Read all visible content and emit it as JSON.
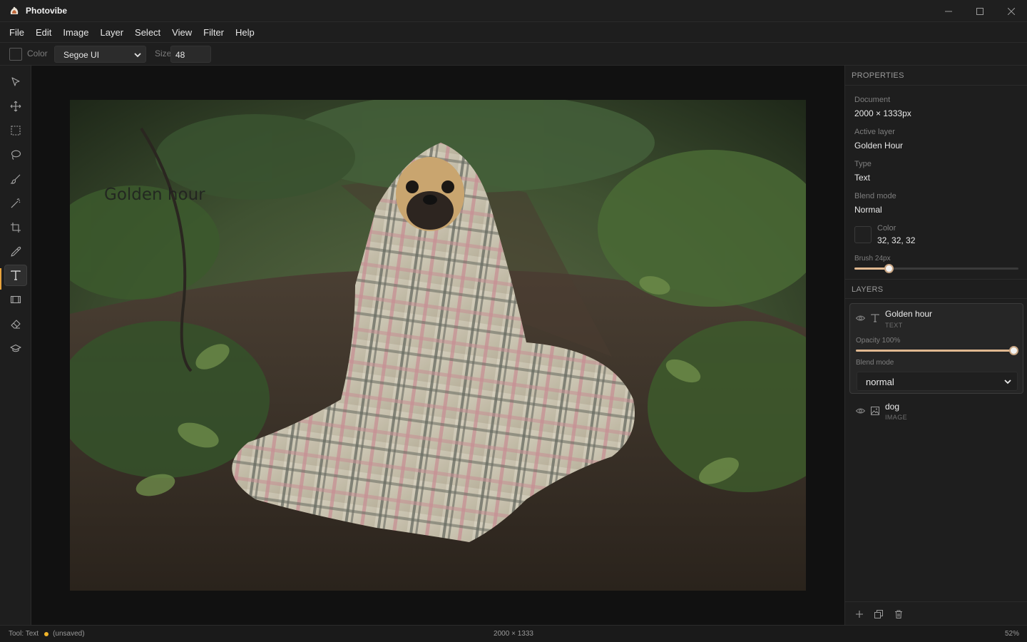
{
  "app": {
    "title": "Photovibe",
    "menu": [
      "File",
      "Edit",
      "Image",
      "Layer",
      "Select",
      "View",
      "Filter",
      "Help"
    ]
  },
  "options": {
    "color_label": "Color",
    "font": "Segoe UI",
    "size_label": "Size",
    "size_value": "48"
  },
  "toolbar": {
    "tools": [
      "select-tool",
      "move-tool",
      "marquee-tool",
      "lasso-tool",
      "brush-tool",
      "magic-wand-tool",
      "crop-tool",
      "eyedropper-tool",
      "text-tool",
      "filmstrip-tool",
      "eraser-tool",
      "stamp-tool"
    ],
    "active_tool": "text-tool"
  },
  "canvas": {
    "overlay_text": "Golden hour",
    "image_subject": "pug wrapped in plaid blanket in forest"
  },
  "properties": {
    "header": "PROPERTIES",
    "document_label": "Document",
    "document_value": "2000 × 1333px",
    "active_layer_label": "Active layer",
    "active_layer_value": "Golden Hour",
    "type_label": "Type",
    "type_value": "Text",
    "blend_label": "Blend mode",
    "blend_value": "Normal",
    "color_label": "Color",
    "color_value": "32, 32, 32",
    "brush_label": "Brush 24px",
    "brush_level": 0.21
  },
  "layers": {
    "header": "LAYERS",
    "items": [
      {
        "name": "Golden hour",
        "kind": "TEXT",
        "opacity_label": "Opacity 100%",
        "opacity_level": 1.0,
        "blend_label": "Blend mode",
        "blend_value": "normal"
      },
      {
        "name": "dog",
        "kind": "IMAGE"
      }
    ]
  },
  "status": {
    "tool": "Tool: Text",
    "saved_state": "(unsaved)",
    "dimensions": "2000 × 1333",
    "zoom": "52%"
  },
  "colors": {
    "accent": "#e8a33c",
    "unsaved_dot": "#f0b429",
    "slider": "#e0b890"
  }
}
